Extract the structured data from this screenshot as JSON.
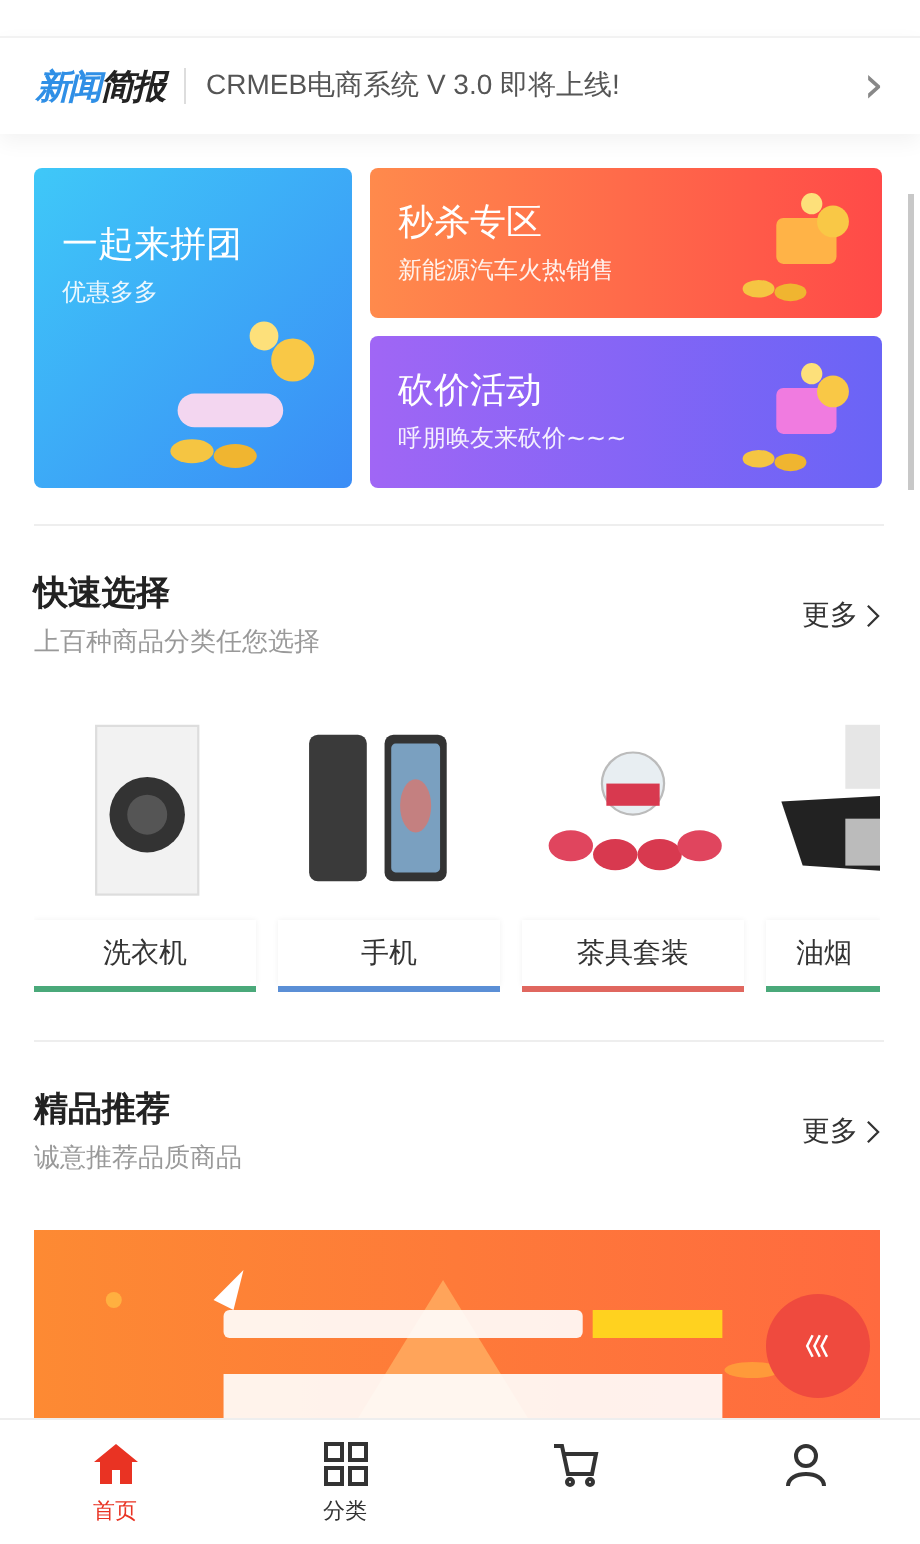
{
  "news": {
    "logo": [
      "新闻",
      "简报"
    ],
    "text": "CRMEB电商系统 V 3.0 即将上线!",
    "arrow": "›"
  },
  "promos": [
    {
      "title": "一起来拼团",
      "subtitle": "优惠多多"
    },
    {
      "title": "秒杀专区",
      "subtitle": "新能源汽车火热销售"
    },
    {
      "title": "砍价活动",
      "subtitle": "呼朋唤友来砍价~~~"
    }
  ],
  "quick": {
    "title": "快速选择",
    "subtitle": "上百种商品分类任您选择",
    "more": "更多",
    "items": [
      {
        "label": "洗衣机",
        "color": "#4aa97a"
      },
      {
        "label": "手机",
        "color": "#5b8fd6"
      },
      {
        "label": "茶具套装",
        "color": "#e0675f"
      },
      {
        "label": "油烟",
        "color": "#4aa97a"
      }
    ]
  },
  "featured": {
    "title": "精品推荐",
    "subtitle": "诚意推荐品质商品",
    "more": "更多"
  },
  "nav": [
    {
      "kind": "home",
      "label": "首页",
      "selected": true
    },
    {
      "kind": "grid",
      "label": "分类",
      "selected": false
    },
    {
      "kind": "cart",
      "selected": false
    },
    {
      "kind": "user",
      "selected": false
    }
  ]
}
